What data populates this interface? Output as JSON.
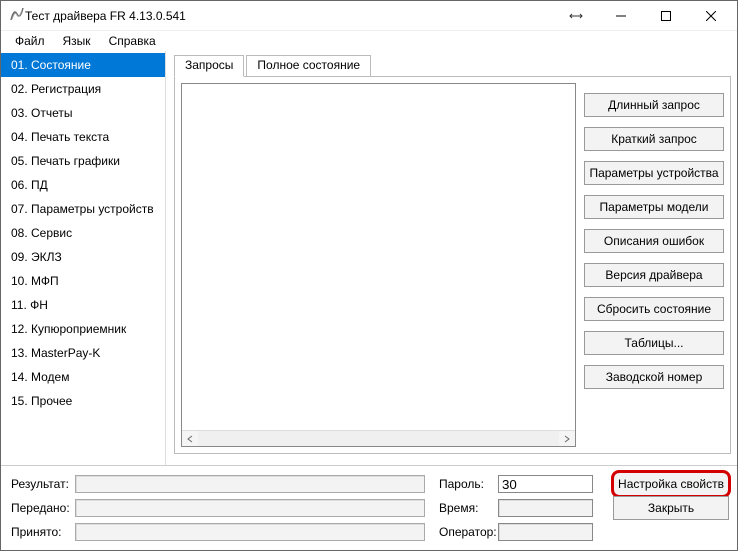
{
  "window": {
    "title": "Тест драйвера FR 4.13.0.541"
  },
  "menu": {
    "file": "Файл",
    "language": "Язык",
    "help": "Справка"
  },
  "sidebar": {
    "items": [
      "01. Состояние",
      "02. Регистрация",
      "03. Отчеты",
      "04. Печать текста",
      "05. Печать графики",
      "06. ПД",
      "07. Параметры устройств",
      "08. Сервис",
      "09. ЭКЛЗ",
      "10. МФП",
      "11. ФН",
      "12. Купюроприемник",
      "13. MasterPay-K",
      "14. Модем",
      "15. Прочее"
    ],
    "selected_index": 0
  },
  "tabs": {
    "items": [
      "Запросы",
      "Полное состояние"
    ],
    "active_index": 0
  },
  "buttons": {
    "long_request": "Длинный запрос",
    "short_request": "Краткий запрос",
    "device_params": "Параметры устройства",
    "model_params": "Параметры модели",
    "error_desc": "Описания ошибок",
    "driver_version": "Версия драйвера",
    "reset_state": "Сбросить состояние",
    "tables": "Таблицы...",
    "factory_number": "Заводской номер"
  },
  "bottom": {
    "result_label": "Результат:",
    "result_value": "",
    "sent_label": "Передано:",
    "sent_value": "",
    "received_label": "Принято:",
    "received_value": "",
    "password_label": "Пароль:",
    "password_value": "30",
    "time_label": "Время:",
    "time_value": "",
    "operator_label": "Оператор:",
    "operator_value": "",
    "properties_btn": "Настройка свойств",
    "close_btn": "Закрыть"
  }
}
